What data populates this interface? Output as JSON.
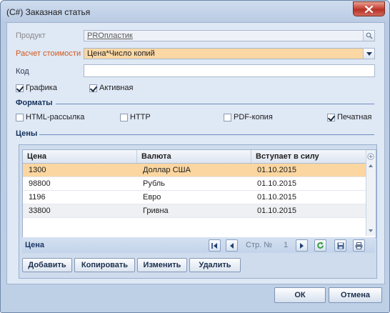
{
  "window": {
    "title": "(C#) Заказная статья"
  },
  "form": {
    "product": {
      "label": "Продукт",
      "value": "PROпластик"
    },
    "cost": {
      "label": "Расчет стоимости",
      "value": "Цена*Число копий"
    },
    "code": {
      "label": "Код",
      "value": ""
    },
    "graphics": {
      "label": "Графика",
      "checked": true
    },
    "active": {
      "label": "Активная",
      "checked": true
    }
  },
  "formats": {
    "heading": "Форматы",
    "items": [
      {
        "label": "HTML-рассылка",
        "checked": false
      },
      {
        "label": "HTTP",
        "checked": false
      },
      {
        "label": "PDF-копия",
        "checked": false
      },
      {
        "label": "Печатная",
        "checked": true
      }
    ]
  },
  "prices": {
    "heading": "Цены",
    "columns": [
      "Цена",
      "Валюта",
      "Вступает в силу"
    ],
    "rows": [
      [
        "1300",
        "Доллар США",
        "01.10.2015"
      ],
      [
        "98800",
        "Рубль",
        "01.10.2015"
      ],
      [
        "1196",
        "Евро",
        "01.10.2015"
      ],
      [
        "33800",
        "Гривна",
        "01.10.2015"
      ]
    ],
    "footer_title": "Цена",
    "page_label": "Стр. №",
    "page_number": "1"
  },
  "actions": {
    "add": "Добавить",
    "copy": "Копировать",
    "edit": "Изменить",
    "delete": "Удалить"
  },
  "dialog": {
    "ok": "ОК",
    "cancel": "Отмена"
  },
  "colors": {
    "highlight": "#fad7a3",
    "selected_row": "#fbd6a0",
    "section_heading": "#15325c",
    "cost_label": "#d3591c"
  },
  "icons": [
    "close-icon",
    "search-icon",
    "chevron-down-icon",
    "first-page-icon",
    "prev-page-icon",
    "next-page-icon",
    "refresh-icon",
    "save-icon",
    "print-icon"
  ]
}
